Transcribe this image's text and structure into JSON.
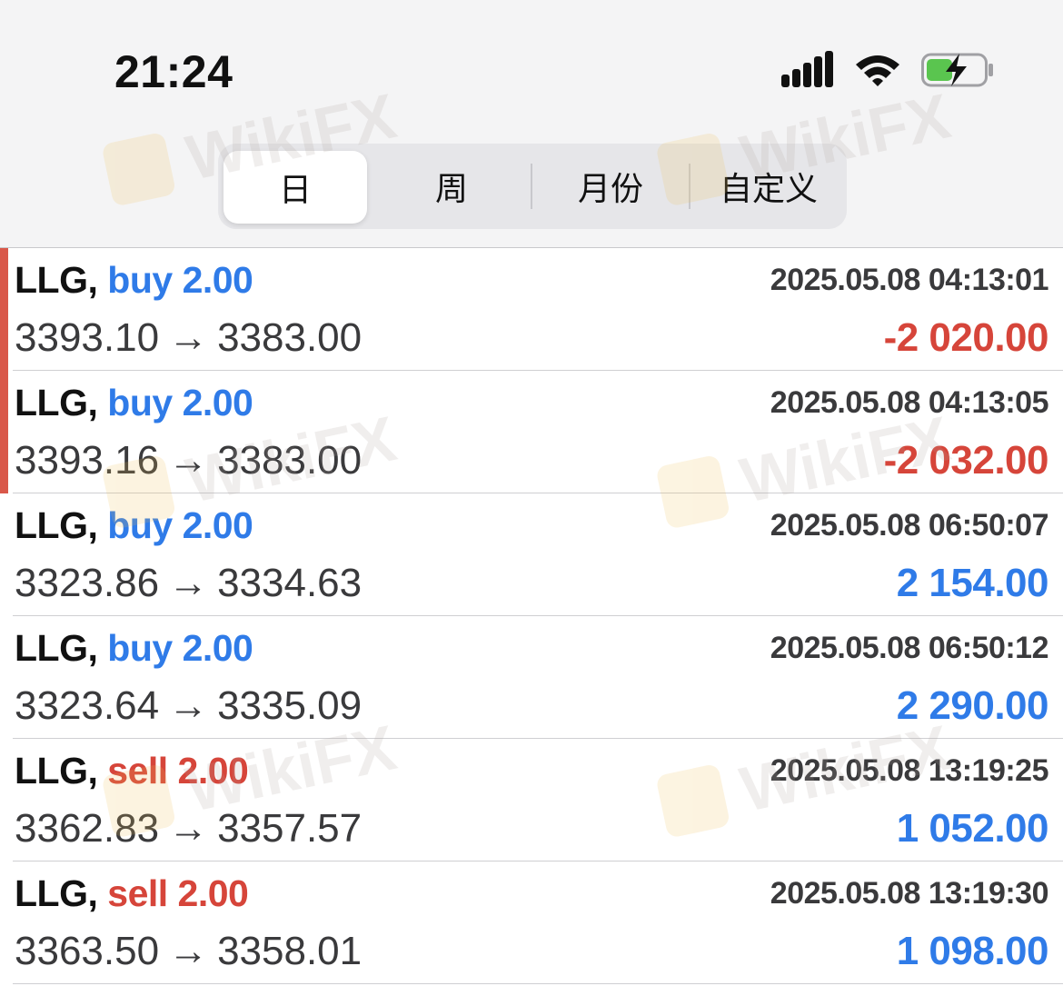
{
  "status_bar": {
    "time": "21:24"
  },
  "segmented_control": {
    "tabs": [
      {
        "label": "日",
        "active": true
      },
      {
        "label": "周",
        "active": false
      },
      {
        "label": "月份",
        "active": false
      },
      {
        "label": "自定义",
        "active": false
      }
    ]
  },
  "watermark": {
    "text": "WikiFX"
  },
  "trades": [
    {
      "symbol": "LLG,",
      "side": "buy 2.00",
      "type": "buy",
      "datetime": "2025.05.08 04:13:01",
      "open_price": "3393.10",
      "arrow": "→",
      "close_price": "3383.00",
      "profit": "-2 020.00",
      "profit_sign": "neg",
      "marked": true
    },
    {
      "symbol": "LLG,",
      "side": "buy 2.00",
      "type": "buy",
      "datetime": "2025.05.08 04:13:05",
      "open_price": "3393.16",
      "arrow": "→",
      "close_price": "3383.00",
      "profit": "-2 032.00",
      "profit_sign": "neg",
      "marked": true
    },
    {
      "symbol": "LLG,",
      "side": "buy 2.00",
      "type": "buy",
      "datetime": "2025.05.08 06:50:07",
      "open_price": "3323.86",
      "arrow": "→",
      "close_price": "3334.63",
      "profit": "2 154.00",
      "profit_sign": "pos",
      "marked": false
    },
    {
      "symbol": "LLG,",
      "side": "buy 2.00",
      "type": "buy",
      "datetime": "2025.05.08 06:50:12",
      "open_price": "3323.64",
      "arrow": "→",
      "close_price": "3335.09",
      "profit": "2 290.00",
      "profit_sign": "pos",
      "marked": false
    },
    {
      "symbol": "LLG,",
      "side": "sell 2.00",
      "type": "sell",
      "datetime": "2025.05.08 13:19:25",
      "open_price": "3362.83",
      "arrow": "→",
      "close_price": "3357.57",
      "profit": "1 052.00",
      "profit_sign": "pos",
      "marked": false
    },
    {
      "symbol": "LLG,",
      "side": "sell 2.00",
      "type": "sell",
      "datetime": "2025.05.08 13:19:30",
      "open_price": "3363.50",
      "arrow": "→",
      "close_price": "3358.01",
      "profit": "1 098.00",
      "profit_sign": "pos",
      "marked": false
    }
  ],
  "colors": {
    "buy": "#2f7be8",
    "sell": "#d6453a",
    "loss": "#d6453a",
    "gain": "#2f7be8",
    "marker": "#d9584a"
  },
  "icons": [
    "cellular-signal-icon",
    "wifi-icon",
    "battery-charging-icon"
  ]
}
